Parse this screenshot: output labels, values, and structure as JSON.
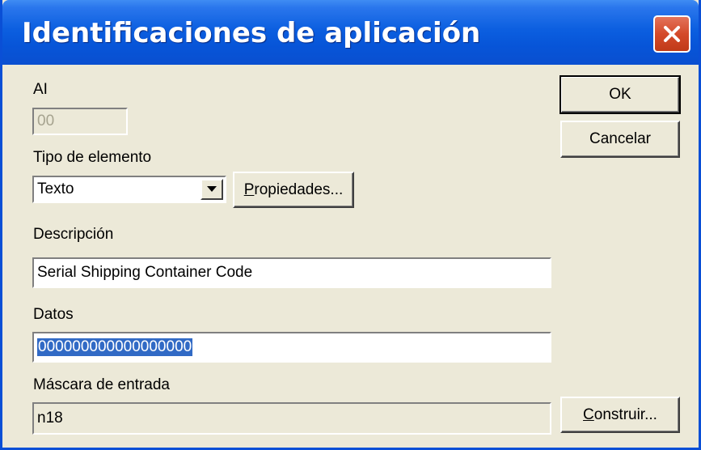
{
  "window": {
    "title": "Identificaciones de aplicación",
    "close_icon": "close-icon"
  },
  "ai": {
    "label": "AI",
    "value": "00"
  },
  "element_type": {
    "label": "Tipo de elemento",
    "selected": "Texto",
    "properties_label_underlined": "P",
    "properties_label_rest": "ropiedades..."
  },
  "description": {
    "label": "Descripción",
    "value": "Serial Shipping Container Code"
  },
  "data": {
    "label": "Datos",
    "value": "000000000000000000"
  },
  "input_mask": {
    "label": "Máscara de entrada",
    "value": "n18",
    "build_label_underlined": "C",
    "build_label_rest": "onstruir..."
  },
  "buttons": {
    "ok": "OK",
    "cancel": "Cancelar"
  },
  "colors": {
    "titlebar": "#0755d8",
    "dialog_bg": "#ece9d8",
    "selection": "#316ac5",
    "close_button": "#d44a2a"
  }
}
